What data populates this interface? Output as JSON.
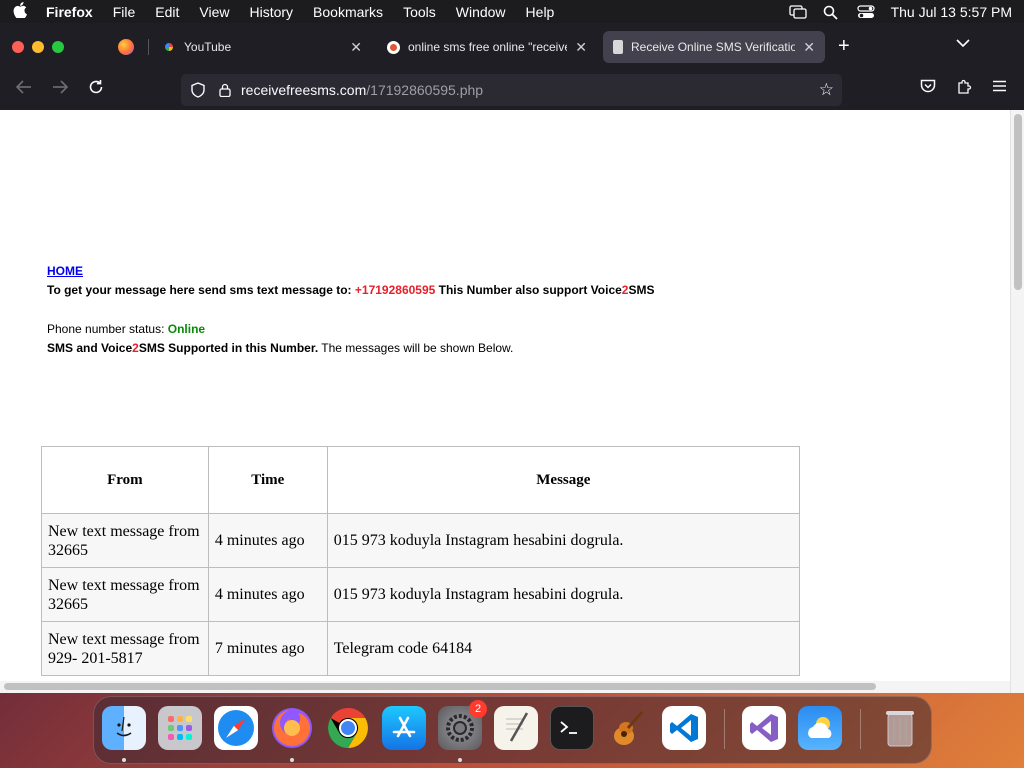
{
  "menubar": {
    "app_name": "Firefox",
    "items": [
      "File",
      "Edit",
      "View",
      "History",
      "Bookmarks",
      "Tools",
      "Window",
      "Help"
    ],
    "clock": "Thu Jul 13  5:57 PM"
  },
  "tabs": [
    {
      "title": "YouTube"
    },
    {
      "title": "online sms free online \"receive\""
    },
    {
      "title": "Receive Online SMS Verification"
    }
  ],
  "urlbar": {
    "host": "receivefreesms.com",
    "path": "/17192860595.php"
  },
  "page": {
    "home_link": "HOME",
    "instruction_prefix": "To get your message here send sms text message to: ",
    "phone_number": "+17192860595",
    "instruction_suffix_a": " This Number also support Voice",
    "instruction_two": "2",
    "instruction_suffix_b": "SMS",
    "status_label": "Phone number status: ",
    "status_value": "Online",
    "support_a": "SMS and Voice",
    "support_two": "2",
    "support_b": "SMS Supported in this Number.",
    "support_tail": " The messages will be shown Below."
  },
  "table": {
    "headers": {
      "from": "From",
      "time": "Time",
      "message": "Message"
    },
    "rows": [
      {
        "from": "New text message from 32665",
        "time": "4 minutes ago",
        "message": "015 973 koduyla Instagram hesabini dogrula."
      },
      {
        "from": "New text message from 32665",
        "time": "4 minutes ago",
        "message": "015 973 koduyla Instagram hesabini dogrula."
      },
      {
        "from": "New text message from 929- 201-5817",
        "time": "7 minutes ago",
        "message": "Telegram code 64184"
      }
    ]
  },
  "dock": {
    "settings_badge": "2",
    "apps": [
      "finder-icon",
      "launchpad-icon",
      "safari-icon",
      "firefox-icon",
      "chrome-icon",
      "app-store-icon",
      "system-settings-icon",
      "textedit-icon",
      "terminal-icon",
      "garageband-icon",
      "vscode-icon",
      "visual-studio-icon",
      "weather-icon",
      "trash-icon"
    ]
  },
  "colors": {
    "phone_red": "#e8202a",
    "online_green": "#0a8a0a",
    "link_blue": "#0000ee"
  }
}
